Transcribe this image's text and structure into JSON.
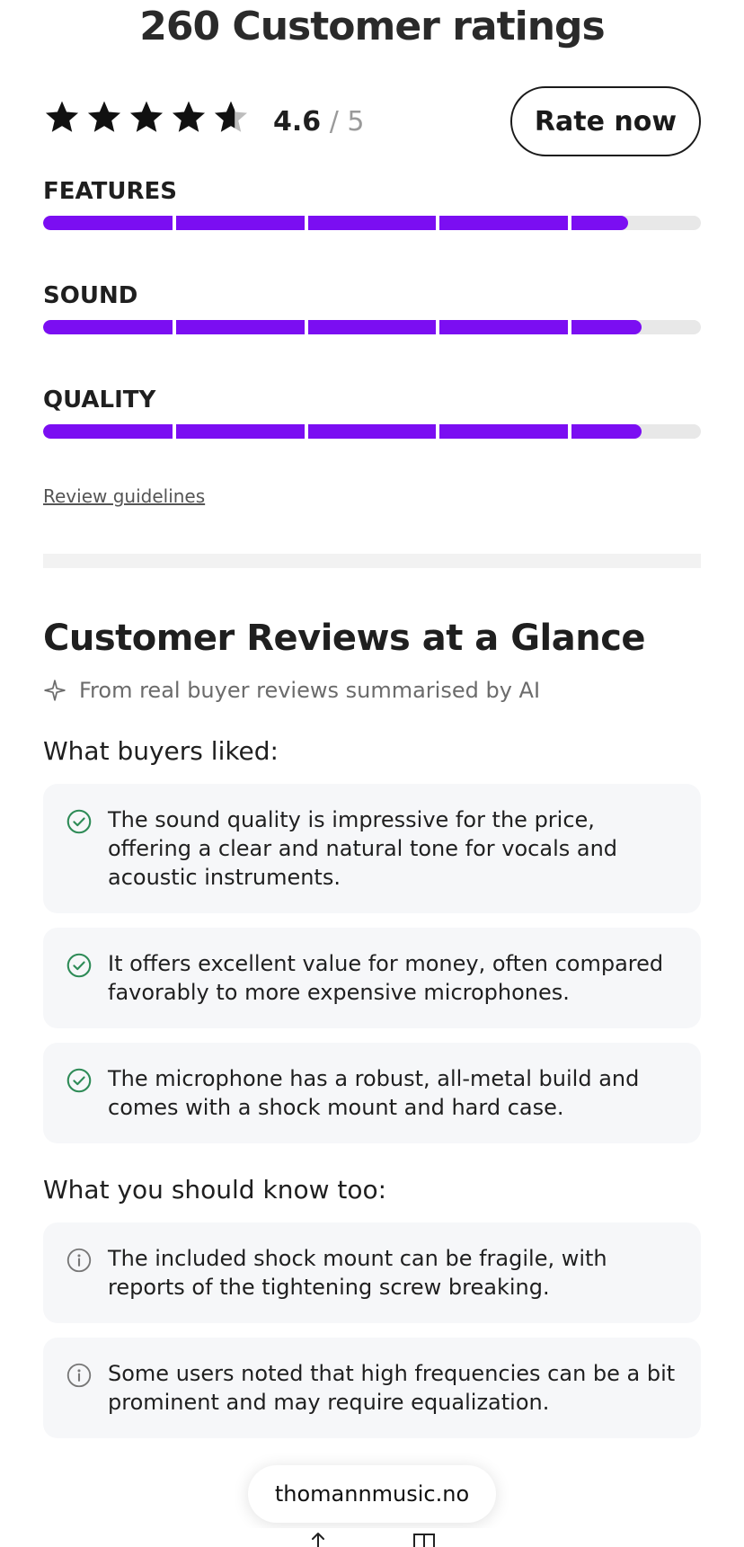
{
  "ratings_header": {
    "title": "260 Customer ratings",
    "score": "4.6",
    "score_of": " / 5",
    "rate_button": "Rate now",
    "stars_value": 4.6,
    "stars_max": 5
  },
  "rating_bars": [
    {
      "label": "FEATURES",
      "fill_fraction": 0.89
    },
    {
      "label": "SOUND",
      "fill_fraction": 0.91
    },
    {
      "label": "QUALITY",
      "fill_fraction": 0.91
    }
  ],
  "review_guidelines_link": "Review guidelines",
  "glance": {
    "title": "Customer Reviews at a Glance",
    "ai_note": "From real buyer reviews summarised by AI",
    "liked_heading": "What buyers liked:",
    "liked": [
      "The sound quality is impressive for the price, offering a clear and natural tone for vocals and acoustic instruments.",
      "It offers excellent value for money, often compared favorably to more expensive microphones.",
      "The microphone has a robust, all-metal build and comes with a shock mount and hard case."
    ],
    "know_heading": "What you should know too:",
    "know": [
      "The included shock mount can be fragile, with reports of the tightening screw breaking.",
      "Some users noted that high frequencies can be a bit prominent and may require equalization."
    ]
  },
  "browser": {
    "url": "thomannmusic.no"
  },
  "colors": {
    "accent": "#7b0ef2",
    "positive": "#2e8b57",
    "info": "#777777"
  }
}
